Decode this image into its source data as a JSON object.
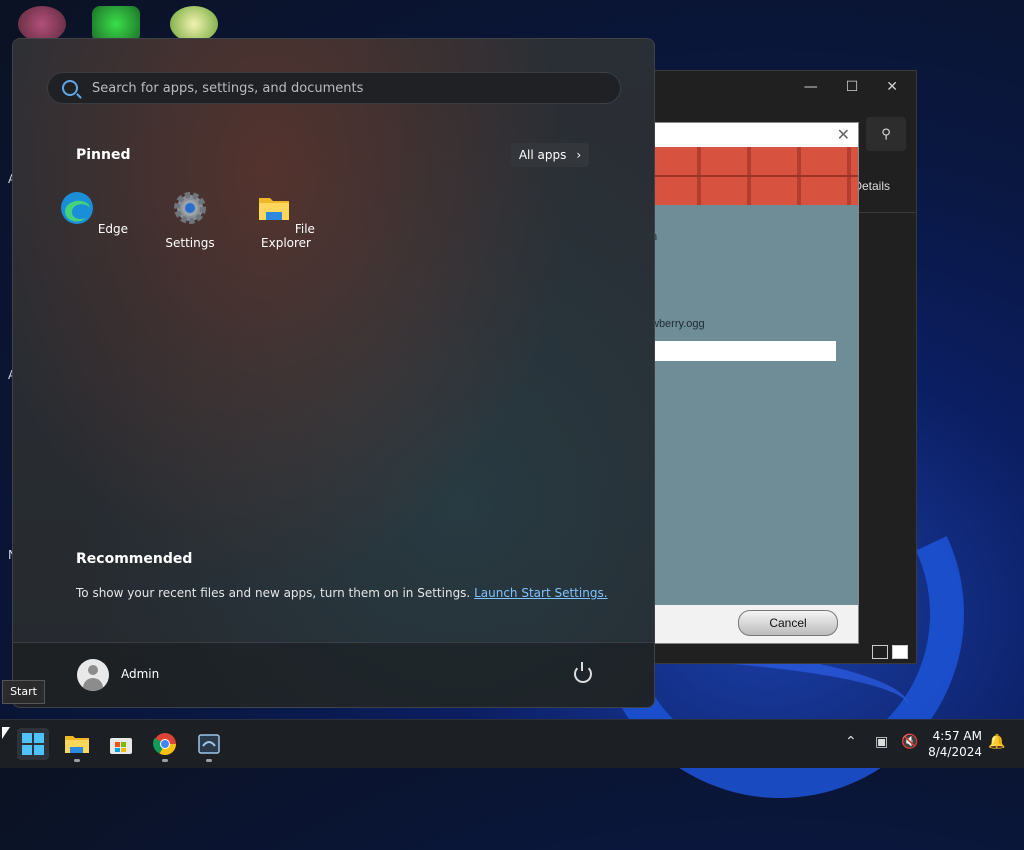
{
  "desktop": {
    "side_letters": [
      "A",
      "A",
      "N"
    ]
  },
  "background_window": {
    "details_label": "Details"
  },
  "dialog": {
    "partial_text_1": "n",
    "partial_text_2": "wberry.ogg",
    "cancel_label": "Cancel"
  },
  "start_menu": {
    "search_placeholder": "Search for apps, settings, and documents",
    "pinned_title": "Pinned",
    "all_apps_label": "All apps",
    "pinned_apps": [
      {
        "label": "Edge",
        "icon": "edge-icon"
      },
      {
        "label": "Settings",
        "icon": "gear-icon"
      },
      {
        "label": "File Explorer",
        "icon": "folder-icon"
      }
    ],
    "recommended_title": "Recommended",
    "recommended_text": "To show your recent files and new apps, turn them on in Settings.",
    "recommended_link": "Launch Start Settings.",
    "user_name": "Admin"
  },
  "tooltip": "Start",
  "taskbar": {
    "time": "4:57 AM",
    "date": "8/4/2024"
  },
  "colors": {
    "accent": "#4cc2ff",
    "link": "#7fc1ff"
  }
}
